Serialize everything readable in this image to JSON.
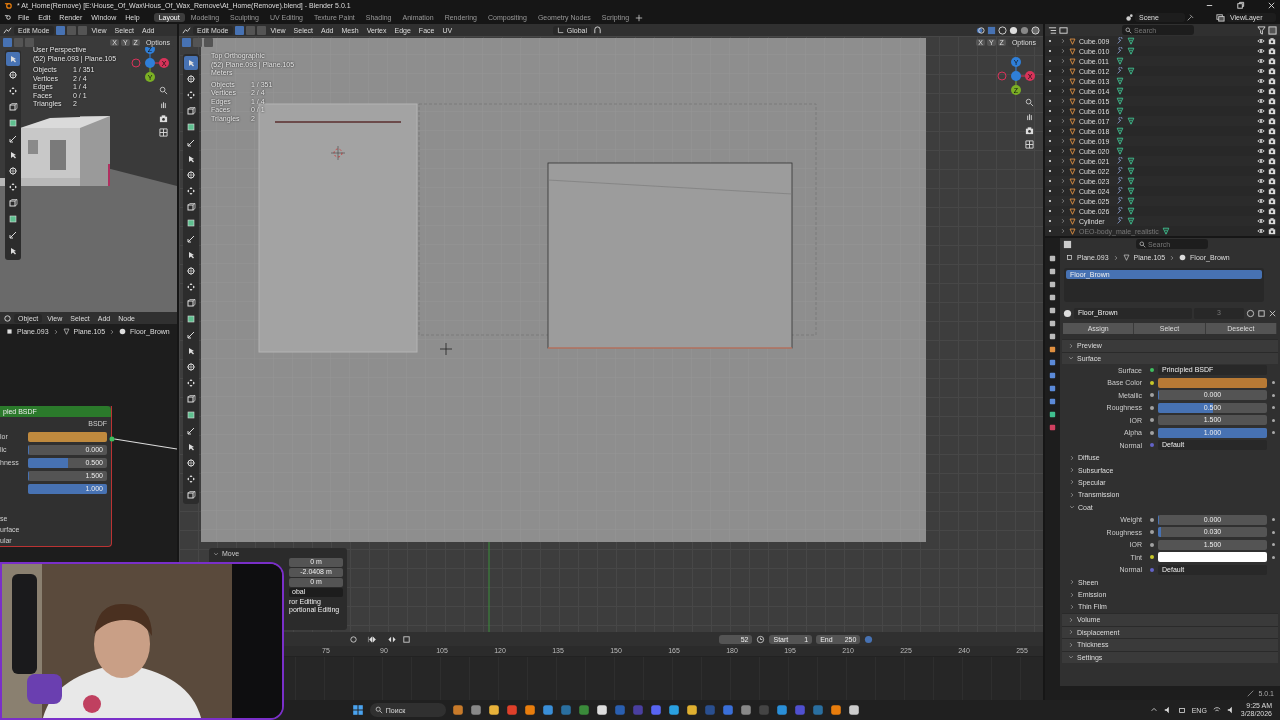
{
  "window": {
    "title": "* At_Home(Remove) [E:\\House_Of_Wax\\Hous_Of_Wax_Remove\\At_Home(Remove).blend] - Blender 5.0.1"
  },
  "menu": [
    "File",
    "Edit",
    "Render",
    "Window",
    "Help"
  ],
  "workspaces": [
    {
      "label": "Layout",
      "selected": true
    },
    {
      "label": "Modeling",
      "selected": false
    },
    {
      "label": "Sculpting",
      "selected": false
    },
    {
      "label": "UV Editing",
      "selected": false
    },
    {
      "label": "Texture Paint",
      "selected": false
    },
    {
      "label": "Shading",
      "selected": false
    },
    {
      "label": "Animation",
      "selected": false
    },
    {
      "label": "Rendering",
      "selected": false
    },
    {
      "label": "Compositing",
      "selected": false
    },
    {
      "label": "Geometry Nodes",
      "selected": false
    },
    {
      "label": "Scripting",
      "selected": false
    }
  ],
  "scene": "Scene",
  "view_layer": "ViewLayer",
  "small_viewport": {
    "mode": "Edit Mode",
    "menus": [
      "View",
      "Select",
      "Add"
    ],
    "axes": [
      "X",
      "Y",
      "Z"
    ],
    "options": "Options",
    "view_name": "User Perspective",
    "object": "(52) Plane.093 | Plane.105",
    "stats": [
      {
        "label": "Objects",
        "value": "1 / 351"
      },
      {
        "label": "Vertices",
        "value": "2 / 4"
      },
      {
        "label": "Edges",
        "value": "1 / 4"
      },
      {
        "label": "Faces",
        "value": "0 / 1"
      },
      {
        "label": "Triangles",
        "value": "2"
      }
    ],
    "gizmo": [
      "Z",
      "Y",
      "X"
    ]
  },
  "node_editor": {
    "mode": "Object",
    "menus": [
      "View",
      "Select",
      "Add",
      "Node"
    ],
    "breadcrumbs": [
      "Plane.093",
      "Plane.105",
      "Floor_Brown"
    ],
    "node": {
      "title": "pled BSDF",
      "output": "BSDF",
      "rows": [
        {
          "kind": "color",
          "label": "lor",
          "color": "#c08a3e"
        },
        {
          "kind": "slider",
          "label": "lic",
          "value": "0.000",
          "level": 0
        },
        {
          "kind": "slider",
          "label": "hness",
          "value": "0.500",
          "level": 0.5
        },
        {
          "kind": "slider",
          "value": "1.500",
          "level": 0
        },
        {
          "kind": "slider",
          "value": "1.000",
          "level": 1
        }
      ],
      "sections": [
        "se",
        "urface",
        "ular"
      ]
    }
  },
  "viewport": {
    "mode": "Edit Mode",
    "menus": [
      "View",
      "Select",
      "Add",
      "Mesh",
      "Vertex",
      "Edge",
      "Face",
      "UV"
    ],
    "orientation": "Global",
    "axes": [
      "X",
      "Y",
      "Z"
    ],
    "options": "Options",
    "view_name": "Top Orthographic",
    "object": "(52) Plane.093 | Plane.105",
    "units": "Meters",
    "stats": [
      {
        "label": "Objects",
        "value": "1 / 351"
      },
      {
        "label": "Vertices",
        "value": "2 / 4"
      },
      {
        "label": "Edges",
        "value": "1 / 4"
      },
      {
        "label": "Faces",
        "value": "0 / 1"
      },
      {
        "label": "Triangles",
        "value": "2"
      }
    ],
    "gizmo": [
      "Y",
      "Z",
      "X"
    ]
  },
  "move_panel": {
    "title": "Move",
    "values": [
      "0 m",
      "-2.0408 m",
      "0 m"
    ],
    "orientation": "obal",
    "options": [
      "ror Editing",
      "portional Editing"
    ]
  },
  "timeline": {
    "frame": "52",
    "start_label": "Start",
    "start": "1",
    "end_label": "End",
    "end": "250",
    "ticks": [
      "75",
      "90",
      "105",
      "120",
      "135",
      "150",
      "165",
      "180",
      "195",
      "210",
      "225",
      "240",
      "255"
    ]
  },
  "outliner": {
    "search": {
      "placeholder": "Search"
    },
    "rows": [
      {
        "name": "Cube.009",
        "modifier": true,
        "dimmed": false
      },
      {
        "name": "Cube.010",
        "modifier": true,
        "dimmed": false
      },
      {
        "name": "Cube.011",
        "modifier": false,
        "dimmed": false
      },
      {
        "name": "Cube.012",
        "modifier": true,
        "dimmed": false
      },
      {
        "name": "Cube.013",
        "modifier": false,
        "dimmed": false
      },
      {
        "name": "Cube.014",
        "modifier": false,
        "dimmed": false
      },
      {
        "name": "Cube.015",
        "modifier": false,
        "dimmed": false
      },
      {
        "name": "Cube.016",
        "modifier": false,
        "dimmed": false
      },
      {
        "name": "Cube.017",
        "modifier": true,
        "dimmed": false
      },
      {
        "name": "Cube.018",
        "modifier": false,
        "dimmed": false
      },
      {
        "name": "Cube.019",
        "modifier": false,
        "dimmed": false
      },
      {
        "name": "Cube.020",
        "modifier": false,
        "dimmed": false
      },
      {
        "name": "Cube.021",
        "modifier": true,
        "dimmed": false
      },
      {
        "name": "Cube.022",
        "modifier": true,
        "dimmed": false
      },
      {
        "name": "Cube.023",
        "modifier": true,
        "dimmed": false
      },
      {
        "name": "Cube.024",
        "modifier": true,
        "dimmed": false
      },
      {
        "name": "Cube.025",
        "modifier": true,
        "dimmed": false
      },
      {
        "name": "Cube.026",
        "modifier": true,
        "dimmed": false
      },
      {
        "name": "Cylinder",
        "modifier": true,
        "dimmed": false
      },
      {
        "name": "OEO-body_male_realistic",
        "modifier": false,
        "dimmed": true
      }
    ]
  },
  "properties": {
    "search": {
      "placeholder": "Search"
    },
    "breadcrumbs": [
      "Plane.093",
      "Plane.105",
      "Floor_Brown"
    ],
    "slots": [
      {
        "name": "Floor_Brown",
        "selected": true
      }
    ],
    "material": "Floor_Brown",
    "users": "3",
    "buttons": [
      "Assign",
      "Select",
      "Deselect"
    ],
    "panels": [
      {
        "label": "Preview",
        "expanded": false
      },
      {
        "label": "Surface",
        "expanded": true,
        "fields": [
          {
            "kind": "shader",
            "label": "Surface",
            "value": "Principled BSDF"
          },
          {
            "kind": "color",
            "label": "Base Color",
            "color": "#b87a35"
          },
          {
            "kind": "slider",
            "label": "Metallic",
            "value": "0.000",
            "level": 0
          },
          {
            "kind": "slider",
            "label": "Roughness",
            "value": "0.500",
            "level": 0.5
          },
          {
            "kind": "number",
            "label": "IOR",
            "value": "1.500"
          },
          {
            "kind": "slider",
            "label": "Alpha",
            "value": "1.000",
            "level": 1
          },
          {
            "kind": "vector",
            "label": "Normal",
            "value": "Default"
          }
        ],
        "subpanels": [
          {
            "label": "Diffuse",
            "expanded": false
          },
          {
            "label": "Subsurface",
            "expanded": false
          },
          {
            "label": "Specular",
            "expanded": false
          },
          {
            "label": "Transmission",
            "expanded": false
          },
          {
            "label": "Coat",
            "expanded": true,
            "fields": [
              {
                "kind": "slider",
                "label": "Weight",
                "value": "0.000",
                "level": 0
              },
              {
                "kind": "slider",
                "label": "Roughness",
                "value": "0.030",
                "level": 0.03
              },
              {
                "kind": "number",
                "label": "IOR",
                "value": "1.500"
              },
              {
                "kind": "color",
                "label": "Tint",
                "color": "#ffffff"
              },
              {
                "kind": "vector",
                "label": "Normal",
                "value": "Default"
              }
            ]
          },
          {
            "label": "Sheen",
            "expanded": false
          },
          {
            "label": "Emission",
            "expanded": false
          },
          {
            "label": "Thin Film",
            "expanded": false
          }
        ]
      },
      {
        "label": "Volume",
        "expanded": false
      },
      {
        "label": "Displacement",
        "expanded": false
      },
      {
        "label": "Thickness",
        "expanded": false
      },
      {
        "label": "Settings",
        "expanded": true
      }
    ]
  },
  "status": {
    "version": "5.0.1"
  },
  "taskbar": {
    "search": {
      "placeholder": "Поиск"
    },
    "language": "ENG",
    "time": "9:25 AM",
    "date": "3/28/2026"
  }
}
